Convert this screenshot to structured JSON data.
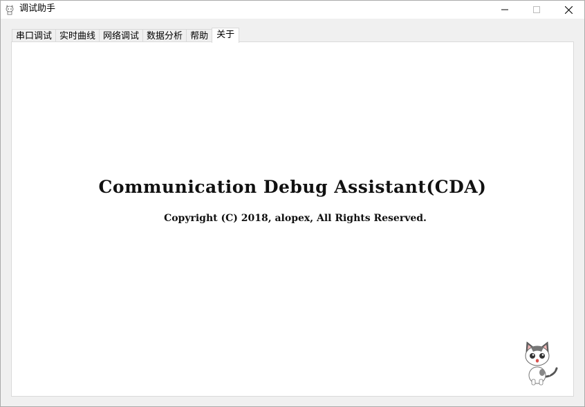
{
  "window": {
    "title": "调试助手",
    "icon": "cat-icon",
    "controls": [
      "minimize-icon",
      "maximize-icon",
      "close-icon"
    ]
  },
  "tabs": [
    {
      "label": "串口调试",
      "active": false
    },
    {
      "label": "实时曲线",
      "active": false
    },
    {
      "label": "网络调试",
      "active": false
    },
    {
      "label": "数据分析",
      "active": false
    },
    {
      "label": "帮助",
      "active": false
    },
    {
      "label": "关于",
      "active": true
    }
  ],
  "about": {
    "title": "Communication Debug Assistant(CDA)",
    "copyright": "Copyright (C) 2018, alopex, All Rights Reserved.",
    "mascot": "cat-mascot-image"
  }
}
